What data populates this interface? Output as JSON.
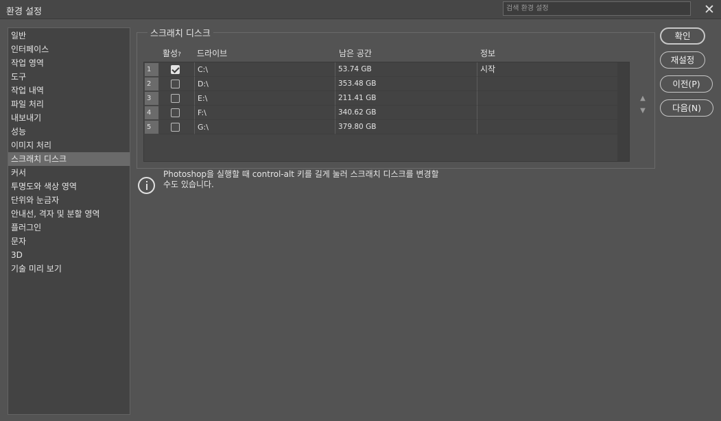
{
  "window": {
    "title": "환경 설정",
    "search_placeholder": "검색 환경 설정",
    "close_glyph": "✕"
  },
  "sidebar": {
    "items": [
      {
        "label": "일반",
        "selected": false
      },
      {
        "label": "인터페이스",
        "selected": false
      },
      {
        "label": "작업 영역",
        "selected": false
      },
      {
        "label": "도구",
        "selected": false
      },
      {
        "label": "작업 내역",
        "selected": false
      },
      {
        "label": "파일 처리",
        "selected": false
      },
      {
        "label": "내보내기",
        "selected": false
      },
      {
        "label": "성능",
        "selected": false
      },
      {
        "label": "이미지 처리",
        "selected": false
      },
      {
        "label": "스크래치 디스크",
        "selected": true
      },
      {
        "label": "커서",
        "selected": false
      },
      {
        "label": "투명도와 색상 영역",
        "selected": false
      },
      {
        "label": "단위와 눈금자",
        "selected": false
      },
      {
        "label": "안내선, 격자 및 분할 영역",
        "selected": false
      },
      {
        "label": "플러그인",
        "selected": false
      },
      {
        "label": "문자",
        "selected": false
      },
      {
        "label": "3D",
        "selected": false
      },
      {
        "label": "기술 미리 보기",
        "selected": false
      }
    ]
  },
  "scratch": {
    "group_title": "스크래치 디스크",
    "columns": {
      "active": "활성",
      "active_help": "?",
      "drive": "드라이브",
      "space": "남은 공간",
      "info": "정보"
    },
    "rows": [
      {
        "num": "1",
        "checked": true,
        "drive": "C:\\",
        "space": "53.74 GB",
        "info": "시작"
      },
      {
        "num": "2",
        "checked": false,
        "drive": "D:\\",
        "space": "353.48 GB",
        "info": ""
      },
      {
        "num": "3",
        "checked": false,
        "drive": "E:\\",
        "space": "211.41 GB",
        "info": ""
      },
      {
        "num": "4",
        "checked": false,
        "drive": "F:\\",
        "space": "340.62 GB",
        "info": ""
      },
      {
        "num": "5",
        "checked": false,
        "drive": "G:\\",
        "space": "379.80 GB",
        "info": ""
      }
    ],
    "up_glyph": "▲",
    "down_glyph": "▼"
  },
  "buttons": {
    "ok": "확인",
    "reset": "재설정",
    "prev": "이전(P)",
    "next": "다음(N)"
  },
  "info": {
    "text_line1": "Photoshop을 실행할 때 control-alt 키를 길게 눌러 스크래치 디스크를 변경할",
    "text_line2": "수도 있습니다."
  },
  "colors": {
    "background": "#535353",
    "panel": "#434343",
    "selected": "#6a6a6a"
  }
}
